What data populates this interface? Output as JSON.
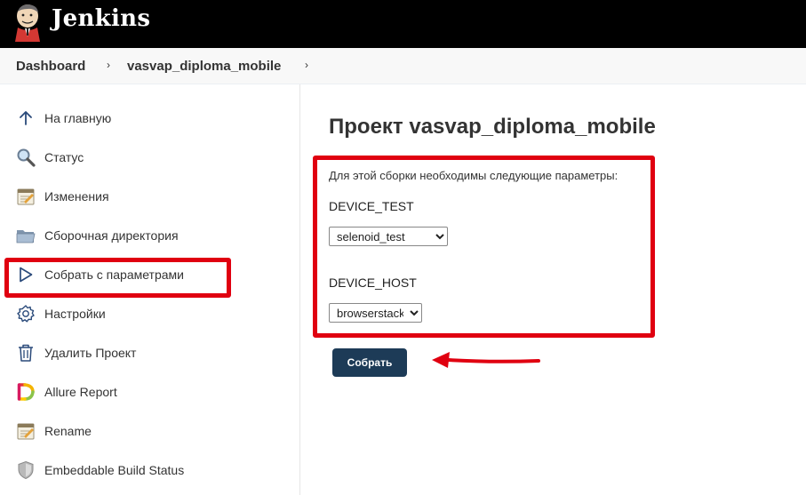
{
  "header": {
    "brand": "Jenkins"
  },
  "breadcrumb": {
    "items": [
      "Dashboard",
      "vasvap_diploma_mobile"
    ],
    "separator": "›"
  },
  "sidebar": {
    "items": [
      {
        "label": "На главную",
        "icon": "arrow-up-icon"
      },
      {
        "label": "Статус",
        "icon": "search-icon"
      },
      {
        "label": "Изменения",
        "icon": "notepad-icon"
      },
      {
        "label": "Сборочная директория",
        "icon": "folder-icon"
      },
      {
        "label": "Собрать с параметрами",
        "icon": "play-icon"
      },
      {
        "label": "Настройки",
        "icon": "gear-icon"
      },
      {
        "label": "Удалить Проект",
        "icon": "trash-icon"
      },
      {
        "label": "Allure Report",
        "icon": "allure-icon"
      },
      {
        "label": "Rename",
        "icon": "notepad-icon"
      },
      {
        "label": "Embeddable Build Status",
        "icon": "shield-icon"
      }
    ]
  },
  "main": {
    "title": "Проект vasvap_diploma_mobile",
    "params_description": "Для этой сборки необходимы следующие параметры:",
    "params": [
      {
        "name": "DEVICE_TEST",
        "value": "selenoid_test"
      },
      {
        "name": "DEVICE_HOST",
        "value": "browserstack"
      }
    ],
    "build_button": "Собрать"
  },
  "colors": {
    "header_bg": "#000000",
    "button_bg": "#1d3b57",
    "highlight": "#e00010"
  }
}
